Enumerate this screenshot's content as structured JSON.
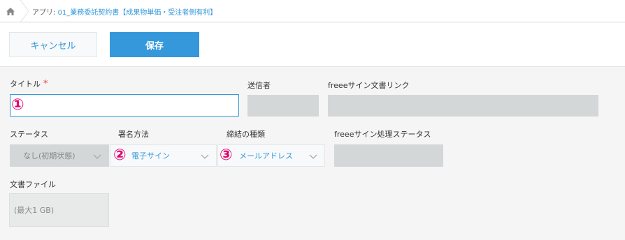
{
  "breadcrumb": {
    "prefix": "アプリ: ",
    "app_name": "01_業務委託契約書【成果物単価・受注者側有利】"
  },
  "toolbar": {
    "cancel_label": "キャンセル",
    "save_label": "保存"
  },
  "form": {
    "title_label": "タイトル",
    "required_mark": "*",
    "sender_label": "送信者",
    "freee_link_label": "freeeサイン文書リンク",
    "status_label": "ステータス",
    "status_value": "なし(初期状態)",
    "signature_method_label": "署名方法",
    "signature_method_value": "電子サイン",
    "contract_type_label": "締結の種類",
    "contract_type_value": "メールアドレス",
    "freee_status_label": "freeeサイン処理ステータス",
    "file_label": "文書ファイル",
    "file_hint": "(最大1 GB)"
  },
  "annotations": {
    "one": "①",
    "two": "②",
    "three": "③"
  },
  "colors": {
    "accent": "#3498db",
    "annotation": "#e6006e",
    "required": "#e74c3c"
  },
  "icons": [
    "home-icon",
    "chevron-down-icon"
  ]
}
